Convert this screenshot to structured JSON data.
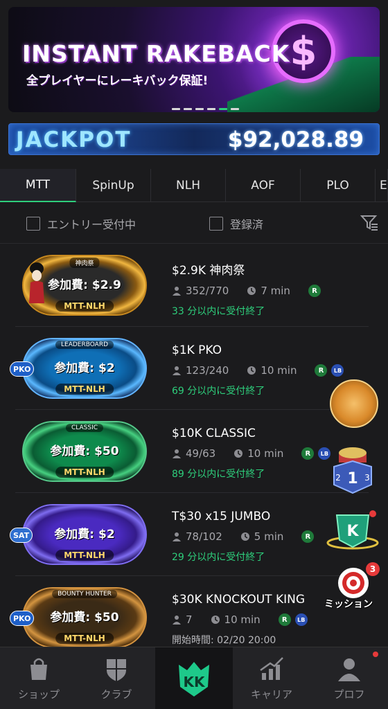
{
  "banner": {
    "title": "INSTANT RAKEBACK",
    "subtitle": "全プレイヤーにレーキバック保証!",
    "coin_symbol": "$",
    "slides": 6,
    "active_slide": 5
  },
  "jackpot": {
    "label": "JACKPOT",
    "amount": "$92,028.89"
  },
  "tabs": [
    {
      "label": "MTT",
      "active": true
    },
    {
      "label": "SpinUp",
      "active": false
    },
    {
      "label": "NLH",
      "active": false
    },
    {
      "label": "AOF",
      "active": false
    },
    {
      "label": "PLO",
      "active": false
    },
    {
      "label": "E",
      "active": false
    }
  ],
  "filters": {
    "entry_open": "エントリー受付中",
    "registered": "登録済"
  },
  "tournaments": [
    {
      "title": "$2.9K 神肉祭",
      "fee": "参加費: $2.9",
      "tag": "MTT-NLH",
      "top_tag": "神肉祭",
      "players": "352/770",
      "time": "7 min",
      "badges": [
        "R"
      ],
      "status": "33 分以内に受付終了"
    },
    {
      "title": "$1K PKO",
      "fee": "参加費: $2",
      "tag": "MTT-NLH",
      "top_tag": "LEADERBOARD",
      "side_badge": "PKO",
      "players": "123/240",
      "time": "10 min",
      "badges": [
        "R",
        "LB"
      ],
      "status": "69 分以内に受付終了"
    },
    {
      "title": "$10K CLASSIC",
      "fee": "参加費: $50",
      "tag": "MTT-NLH",
      "top_tag": "CLASSIC",
      "players": "49/63",
      "time": "10 min",
      "badges": [
        "R",
        "LB"
      ],
      "status": "89 分以内に受付終了"
    },
    {
      "title": "T$30 x15 JUMBO",
      "fee": "参加費: $2",
      "tag": "MTT-NLH",
      "side_badge": "SAT",
      "players": "78/102",
      "time": "5 min",
      "badges": [
        "R"
      ],
      "status": "29 分以内に受付終了"
    },
    {
      "title": "$30K KNOCKOUT KING",
      "fee": "参加費: $50",
      "tag": "MTT-NLH",
      "top_tag": "BOUNTY HUNTER",
      "side_badge": "PKO",
      "players": "7",
      "time": "10 min",
      "badges": [
        "R",
        "LB"
      ],
      "start": "開始時間: 02/20 20:00"
    }
  ],
  "floating": {
    "mission_label": "ミッション",
    "mission_count": "3"
  },
  "bottom_nav": [
    {
      "label": "ショップ",
      "icon": "shop-bag-icon"
    },
    {
      "label": "クラブ",
      "icon": "club-shield-icon"
    },
    {
      "label": "",
      "icon": "kk-logo-icon"
    },
    {
      "label": "キャリア",
      "icon": "career-chart-icon"
    },
    {
      "label": "プロフ",
      "icon": "profile-icon"
    }
  ],
  "colors": {
    "accent": "#2ecf7c",
    "background": "#1b1b1d",
    "muted": "#a8a8ad"
  }
}
